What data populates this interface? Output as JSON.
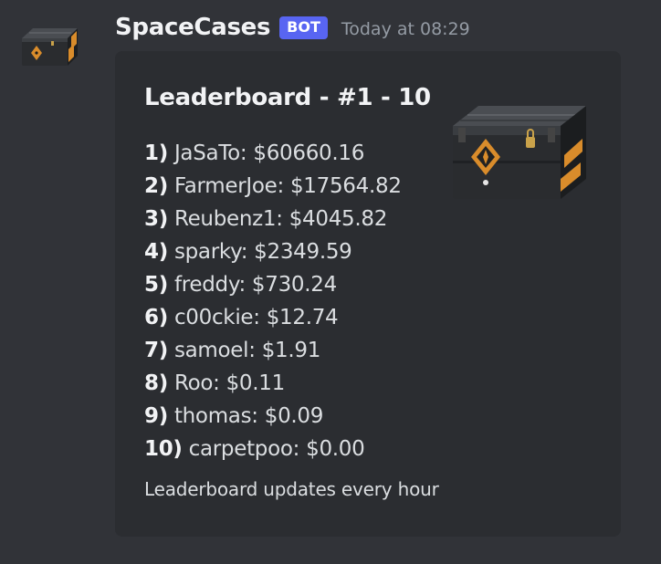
{
  "message": {
    "author": "SpaceCases",
    "badge": "BOT",
    "timestamp": "Today at 08:29",
    "avatar_icon": "crate-avatar-icon"
  },
  "embed": {
    "title": "Leaderboard - #1 - 10",
    "thumbnail_icon": "weapon-case-icon",
    "entries": [
      {
        "rank": "1)",
        "text": "JaSaTo: $60660.16"
      },
      {
        "rank": "2)",
        "text": "FarmerJoe: $17564.82"
      },
      {
        "rank": "3)",
        "text": "Reubenz1: $4045.82"
      },
      {
        "rank": "4)",
        "text": "sparky: $2349.59"
      },
      {
        "rank": "5)",
        "text": "freddy: $730.24"
      },
      {
        "rank": "6)",
        "text": "c00ckie: $12.74"
      },
      {
        "rank": "7)",
        "text": "samoel: $1.91"
      },
      {
        "rank": "8)",
        "text": "Roo: $0.11"
      },
      {
        "rank": "9)",
        "text": "thomas: $0.09"
      },
      {
        "rank": "10)",
        "text": "carpetpoo: $0.00"
      }
    ],
    "footer": "Leaderboard updates every hour"
  },
  "colors": {
    "background": "#313338",
    "embed_background": "#2b2d31",
    "badge": "#5865f2",
    "case_accent": "#d98c2b"
  }
}
